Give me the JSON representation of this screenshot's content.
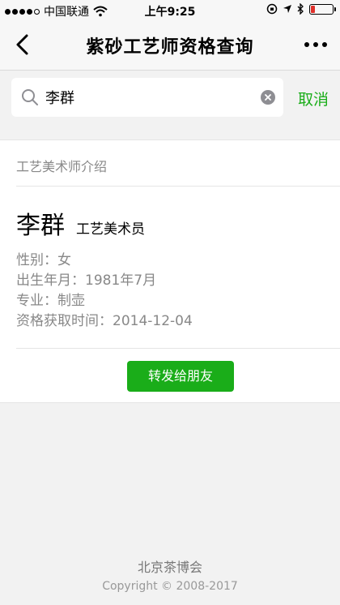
{
  "status_bar": {
    "carrier": "中国联通",
    "time": "上午9:25",
    "signal_bars": 4,
    "signal_max": 5,
    "battery_level": 0.18,
    "battery_color": "#e0302b"
  },
  "nav": {
    "title": "紫砂工艺师资格查询",
    "back_icon": "chevron-left-icon",
    "more_icon": "more-icon"
  },
  "search": {
    "value": "李群",
    "cancel_label": "取消",
    "accent": "#1aad19"
  },
  "card": {
    "section_title": "工艺美术师介绍",
    "name": "李群",
    "rank": "工艺美术员",
    "info": [
      "性别：女",
      "出生年月：1981年7月",
      "专业：制壶",
      "资格获取时间：2014-12-04"
    ],
    "share_label": "转发给朋友"
  },
  "footer": {
    "org": "北京茶博会",
    "copyright": "Copyright © 2008-2017"
  }
}
